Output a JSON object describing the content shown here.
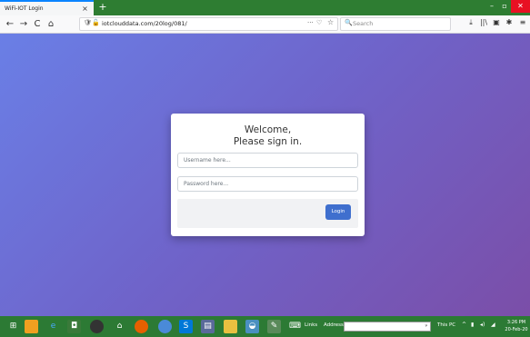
{
  "browser": {
    "tab": {
      "title": "WiFi-IOT Login",
      "close": "×"
    },
    "new_tab": "+",
    "window_controls": {
      "minimize": "–",
      "maximize": "▫",
      "close": "✕"
    },
    "nav": {
      "back": "←",
      "forward": "→",
      "reload": "C",
      "home": "⌂"
    },
    "url": "iotclouddata.com/20log/081/",
    "url_actions": {
      "more": "···",
      "pocket": "♡",
      "bookmark": "☆"
    },
    "search_placeholder": "Search",
    "toolbar_icons": {
      "downloads": "⤓",
      "library": "||\\",
      "reader": "▣",
      "extension": "✱",
      "menu": "≡"
    }
  },
  "login": {
    "title_line1": "Welcome,",
    "title_line2": "Please sign in.",
    "username_placeholder": "Username here...",
    "password_placeholder": "Password here...",
    "login_button": "Login"
  },
  "taskbar": {
    "links_label": "Links",
    "address_label": "Address",
    "address_value": "",
    "this_pc": "This PC",
    "clock_time": "3:26 PM",
    "clock_date": "20-Feb-20"
  },
  "colors": {
    "gradient_start": "#6a7fe6",
    "gradient_end": "#7b4ea8",
    "login_button": "#3f6fce",
    "taskbar": "#2c7a34",
    "tab_strip": "#2e7d32"
  }
}
